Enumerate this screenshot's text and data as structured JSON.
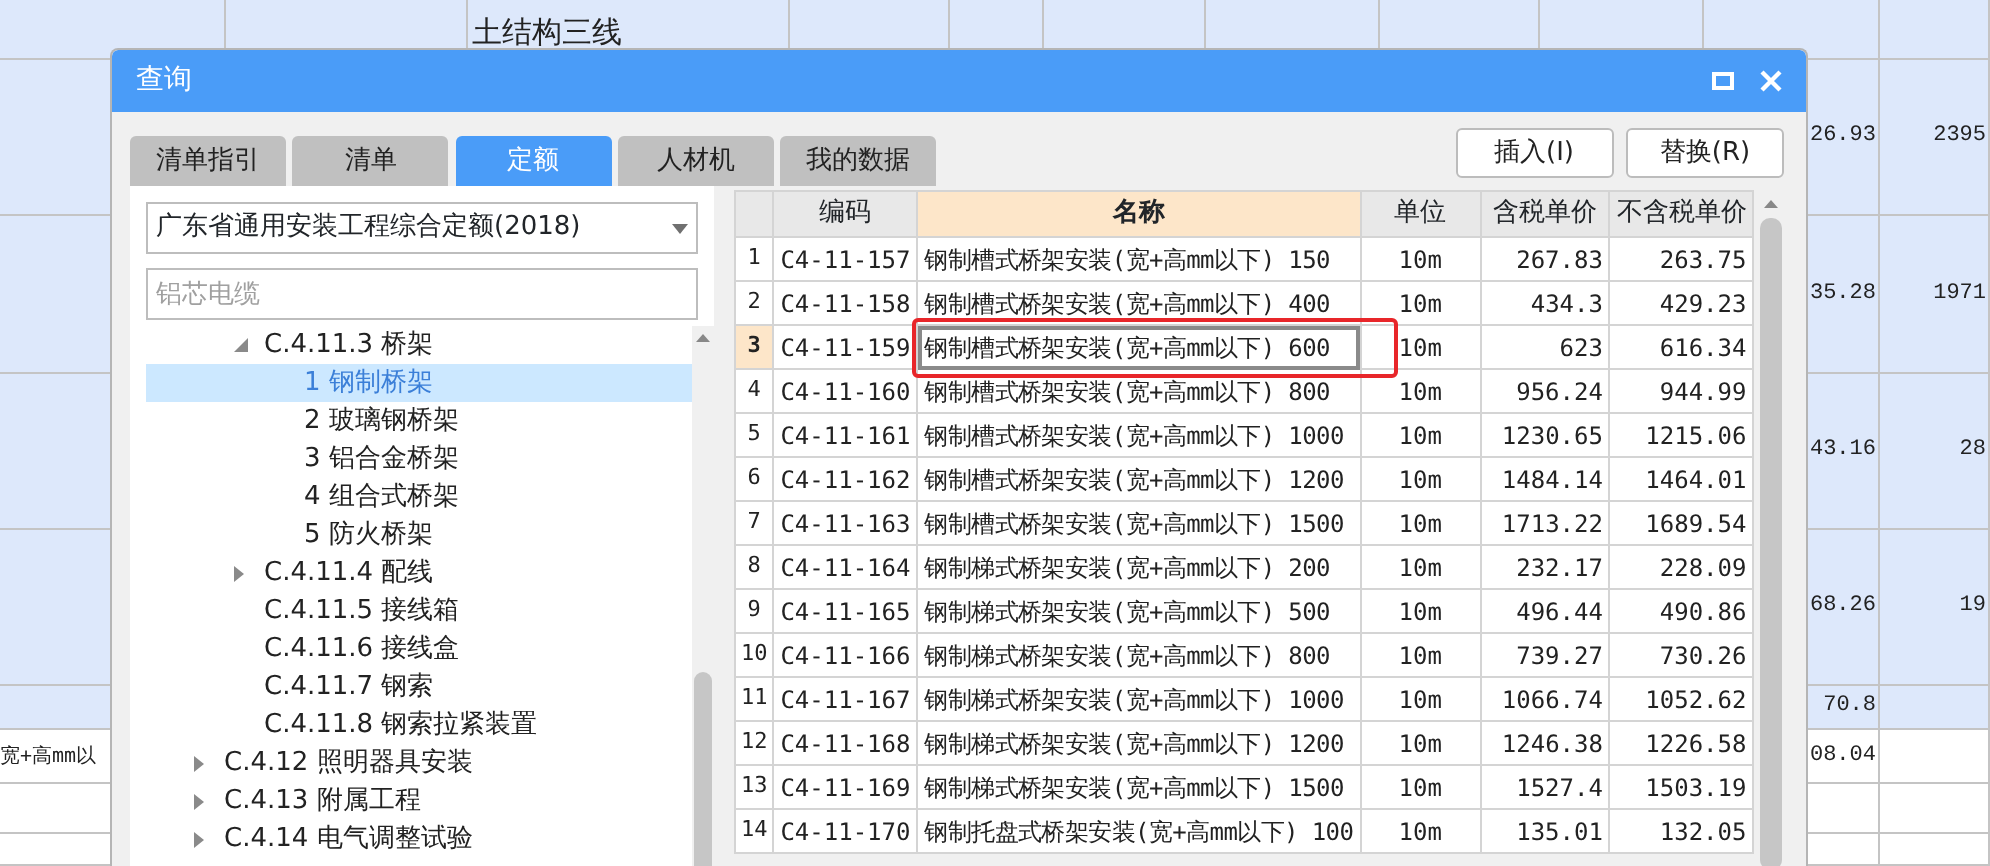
{
  "sheet": {
    "rows": [
      {
        "highlighted": true,
        "column_3": "土结构三线"
      },
      {
        "highlighted": true,
        "column_10": "26.93",
        "column_11": "2395"
      },
      {
        "highlighted": true,
        "column_10": "35.28",
        "column_11": "1971"
      },
      {
        "highlighted": true,
        "column_10": "43.16",
        "column_11": "28"
      },
      {
        "highlighted": true,
        "column_10": "68.26",
        "column_11": "19"
      },
      {
        "highlighted": true,
        "column_10": "70.8"
      },
      {
        "highlighted": false,
        "column_1": "宽+高mm以",
        "column_10": "08.04"
      },
      {
        "highlighted": false
      },
      {
        "highlighted": false
      }
    ]
  },
  "dialog": {
    "title": "查询",
    "tabs": [
      {
        "label": "清单指引",
        "selected": false
      },
      {
        "label": "清单",
        "selected": false
      },
      {
        "label": "定额",
        "selected": true
      },
      {
        "label": "人材机",
        "selected": false
      },
      {
        "label": "我的数据",
        "selected": false
      }
    ],
    "buttons": [
      "插入(I)",
      "替换(R)"
    ],
    "library": {
      "value": "广东省通用安装工程综合定额(2018)"
    },
    "search": {
      "placeholder": "铝芯电缆"
    },
    "tree": [
      {
        "children": [
          {
            "label": "C.4.11.3 桥架",
            "expanded": true,
            "selected": false,
            "children": [
              {
                "label": "1 钢制桥架",
                "selected": true
              },
              {
                "label": "2 玻璃钢桥架",
                "selected": false
              },
              {
                "label": "3 铝合金桥架",
                "selected": false
              },
              {
                "label": "4 组合式桥架",
                "selected": false
              },
              {
                "label": "5 防火桥架",
                "selected": false
              }
            ]
          },
          {
            "label": "C.4.11.4 配线",
            "expanded": false,
            "selected": false
          },
          {
            "label": "C.4.11.5 接线箱",
            "selected": false
          },
          {
            "label": "C.4.11.6 接线盒",
            "selected": false
          },
          {
            "label": "C.4.11.7 钢索",
            "selected": false
          },
          {
            "label": "C.4.11.8 钢索拉紧装置",
            "selected": false
          }
        ]
      },
      {
        "label": "C.4.12 照明器具安装",
        "expanded": false,
        "selected": false
      },
      {
        "label": "C.4.13 附属工程",
        "expanded": false,
        "selected": false
      },
      {
        "label": "C.4.14 电气调整试验",
        "expanded": false,
        "selected": false
      }
    ],
    "table": {
      "columns": [
        "编码",
        "名称",
        "单位",
        "含税单价",
        "不含税单价"
      ],
      "rows": [
        {
          "number": "1",
          "code": "C4-11-157",
          "name": "钢制槽式桥架安装(宽+高mm以下) 150",
          "unit": "10m",
          "price_tax": "267.83",
          "price_notax": "263.75",
          "selected": false
        },
        {
          "number": "2",
          "code": "C4-11-158",
          "name": "钢制槽式桥架安装(宽+高mm以下) 400",
          "unit": "10m",
          "price_tax": "434.3",
          "price_notax": "429.23",
          "selected": false
        },
        {
          "number": "3",
          "code": "C4-11-159",
          "name": "钢制槽式桥架安装(宽+高mm以下) 600",
          "unit": "10m",
          "price_tax": "623",
          "price_notax": "616.34",
          "selected": true
        },
        {
          "number": "4",
          "code": "C4-11-160",
          "name": "钢制槽式桥架安装(宽+高mm以下) 800",
          "unit": "10m",
          "price_tax": "956.24",
          "price_notax": "944.99",
          "selected": false
        },
        {
          "number": "5",
          "code": "C4-11-161",
          "name": "钢制槽式桥架安装(宽+高mm以下) 1000",
          "unit": "10m",
          "price_tax": "1230.65",
          "price_notax": "1215.06",
          "selected": false
        },
        {
          "number": "6",
          "code": "C4-11-162",
          "name": "钢制槽式桥架安装(宽+高mm以下) 1200",
          "unit": "10m",
          "price_tax": "1484.14",
          "price_notax": "1464.01",
          "selected": false
        },
        {
          "number": "7",
          "code": "C4-11-163",
          "name": "钢制槽式桥架安装(宽+高mm以下) 1500",
          "unit": "10m",
          "price_tax": "1713.22",
          "price_notax": "1689.54",
          "selected": false
        },
        {
          "number": "8",
          "code": "C4-11-164",
          "name": "钢制梯式桥架安装(宽+高mm以下) 200",
          "unit": "10m",
          "price_tax": "232.17",
          "price_notax": "228.09",
          "selected": false
        },
        {
          "number": "9",
          "code": "C4-11-165",
          "name": "钢制梯式桥架安装(宽+高mm以下) 500",
          "unit": "10m",
          "price_tax": "496.44",
          "price_notax": "490.86",
          "selected": false
        },
        {
          "number": "10",
          "code": "C4-11-166",
          "name": "钢制梯式桥架安装(宽+高mm以下) 800",
          "unit": "10m",
          "price_tax": "739.27",
          "price_notax": "730.26",
          "selected": false
        },
        {
          "number": "11",
          "code": "C4-11-167",
          "name": "钢制梯式桥架安装(宽+高mm以下) 1000",
          "unit": "10m",
          "price_tax": "1066.74",
          "price_notax": "1052.62",
          "selected": false
        },
        {
          "number": "12",
          "code": "C4-11-168",
          "name": "钢制梯式桥架安装(宽+高mm以下) 1200",
          "unit": "10m",
          "price_tax": "1246.38",
          "price_notax": "1226.58",
          "selected": false
        },
        {
          "number": "13",
          "code": "C4-11-169",
          "name": "钢制梯式桥架安装(宽+高mm以下) 1500",
          "unit": "10m",
          "price_tax": "1527.4",
          "price_notax": "1503.19",
          "selected": false
        },
        {
          "number": "14",
          "code": "C4-11-170",
          "name": "钢制托盘式桥架安装(宽+高mm以下) 100",
          "unit": "10m",
          "price_tax": "135.01",
          "price_notax": "132.05",
          "selected": false
        }
      ]
    }
  }
}
